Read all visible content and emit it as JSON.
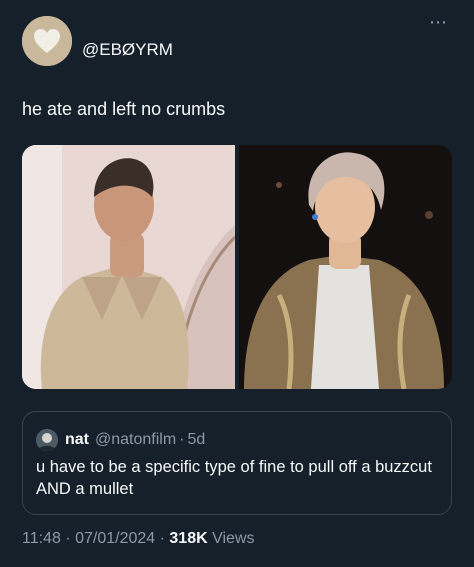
{
  "tweet": {
    "handle": "@EBØYRM",
    "text": "he ate and left no crumbs",
    "more_icon": "more-horizontal-icon"
  },
  "media": {
    "left_alt": "Man with buzzcut in silk shirt",
    "right_alt": "Man with mullet on stage"
  },
  "quote": {
    "name": "nat",
    "handle": "@natonfilm",
    "sep": "·",
    "age": "5d",
    "text": "u have to be a specific type of fine to pull off a buzzcut AND a mullet"
  },
  "footer": {
    "time": "11:48",
    "sep1": "·",
    "date": "07/01/2024",
    "sep2": "·",
    "views_count": "318K",
    "views_label": "Views"
  },
  "colors": {
    "background": "#15202b",
    "text": "#f7f9f9",
    "muted": "#8b98a5",
    "border": "#38444d"
  }
}
